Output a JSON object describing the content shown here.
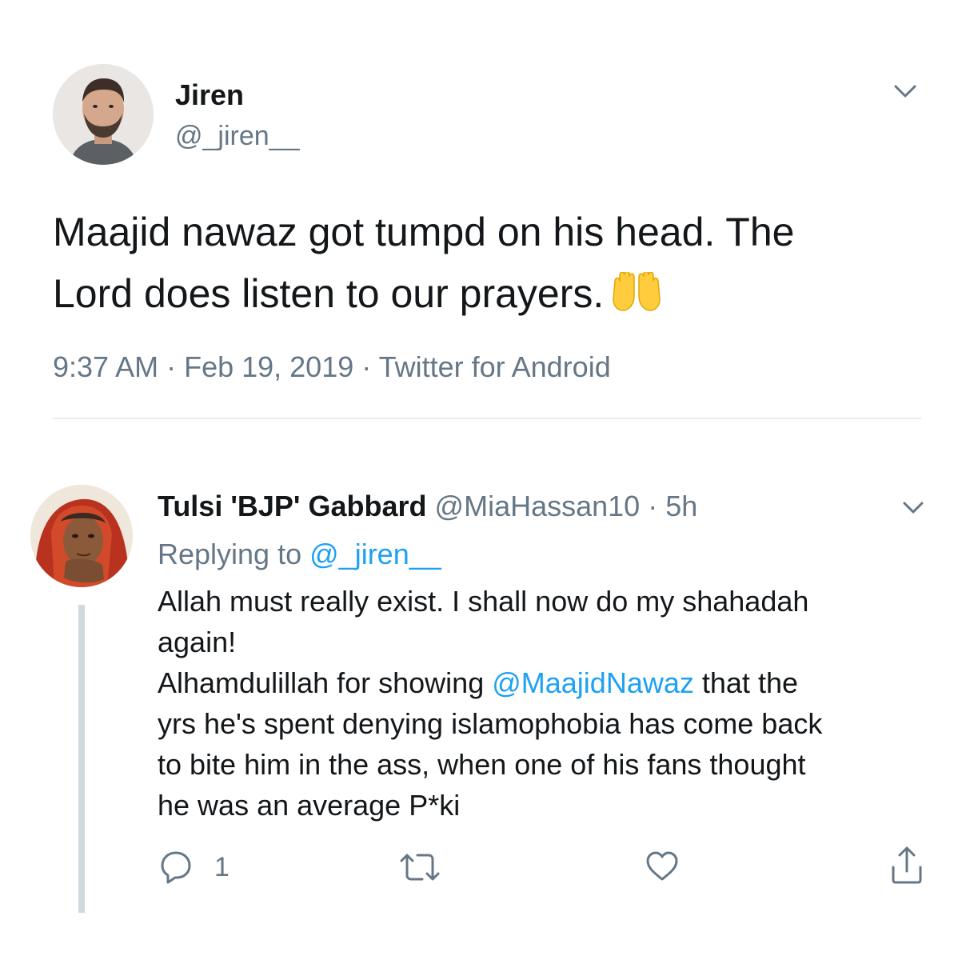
{
  "main_tweet": {
    "display_name": "Jiren",
    "handle": "@_jiren__",
    "text_line1": "Maajid nawaz got tumpd on his head. The",
    "text_line2": "Lord does listen to our prayers.",
    "emoji": "raising-hands-emoji",
    "timestamp": "9:37 AM · Feb 19, 2019 · Twitter for Android"
  },
  "reply": {
    "display_name": "Tulsi 'BJP' Gabbard",
    "handle": "@MiaHassan10",
    "separator": "·",
    "time_ago": "5h",
    "replying_prefix": "Replying to",
    "replying_handle": "@_jiren__",
    "line1": "Allah must really exist. I shall now do my shahadah",
    "line2": "again!",
    "line3_prefix": "Alhamdulillah for showing",
    "line3_mention": "@MaajidNawaz",
    "line3_suffix": "that the",
    "line4": "yrs he's spent denying islamophobia has come back",
    "line5": "to bite him in the ass, when one of his fans thought",
    "line6": "he was an average P*ki",
    "actions": {
      "comment_count": "1"
    }
  },
  "colors": {
    "text": "#14171a",
    "secondary": "#657786",
    "link": "#1da1f2",
    "divider": "#e6ecf0",
    "thread_line": "#cfd9de"
  }
}
